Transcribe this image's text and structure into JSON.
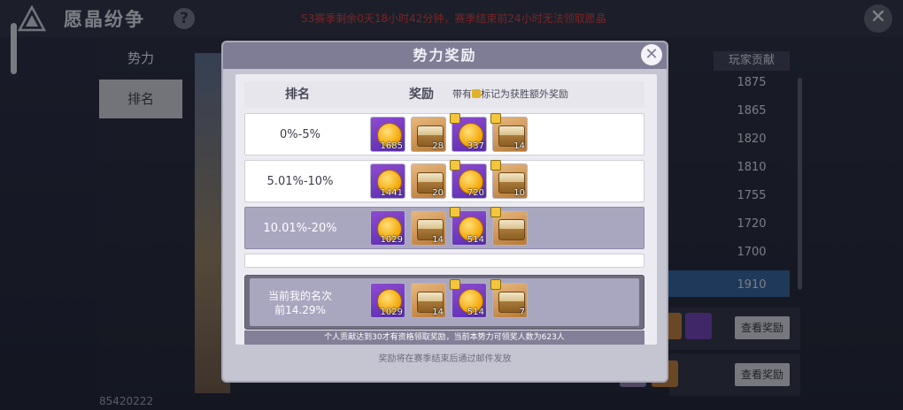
{
  "header": {
    "title": "愿晶纷争",
    "help_icon": "?",
    "notice": "S3赛季剩余0天18小时42分钟，赛季结束前24小时无法领取愿晶",
    "close_icon": "✕"
  },
  "tabs": [
    {
      "label": "势力"
    },
    {
      "label": "排名",
      "selected": true
    }
  ],
  "player_id": "85420222",
  "background_list": {
    "header": "玩家贡献",
    "values": [
      "1875",
      "1865",
      "1820",
      "1810",
      "1755",
      "1720",
      "1700",
      "1910"
    ],
    "view_button_label": "查看奖励"
  },
  "modal": {
    "title": "势力奖励",
    "close_icon": "✕",
    "columns": {
      "rank": "排名",
      "reward": "奖励",
      "note_prefix": "带有",
      "note_suffix": "标记为获胜额外奖励"
    },
    "rows": [
      {
        "rank": "0%-5%",
        "rewards": [
          {
            "type": "coin",
            "qty": "1685",
            "bonus": false
          },
          {
            "type": "chest",
            "qty": "28",
            "bonus": false
          },
          {
            "type": "coin",
            "qty": "337",
            "bonus": true
          },
          {
            "type": "chest",
            "qty": "14",
            "bonus": true
          }
        ]
      },
      {
        "rank": "5.01%-10%",
        "rewards": [
          {
            "type": "coin",
            "qty": "1441",
            "bonus": false
          },
          {
            "type": "chest",
            "qty": "20",
            "bonus": false
          },
          {
            "type": "coin",
            "qty": "720",
            "bonus": true
          },
          {
            "type": "chest",
            "qty": "10",
            "bonus": true
          }
        ]
      },
      {
        "rank": "10.01%-20%",
        "highlight": true,
        "rewards": [
          {
            "type": "coin",
            "qty": "1029",
            "bonus": false
          },
          {
            "type": "chest",
            "qty": "14",
            "bonus": false
          },
          {
            "type": "coin",
            "qty": "514",
            "bonus": true
          },
          {
            "type": "chest",
            "qty": "",
            "bonus": true
          }
        ]
      }
    ],
    "current": {
      "title": "当前我的名次",
      "value": "前14.29%",
      "rewards": [
        {
          "type": "coin",
          "qty": "1029",
          "bonus": false
        },
        {
          "type": "chest",
          "qty": "14",
          "bonus": false
        },
        {
          "type": "coin",
          "qty": "514",
          "bonus": true
        },
        {
          "type": "chest",
          "qty": "7",
          "bonus": true
        }
      ]
    },
    "info": "个人贡献达到30才有资格领取奖励，当前本势力可领奖人数为623人",
    "footer": "奖励将在赛季结束后通过邮件发放"
  },
  "colors": {
    "notice_red": "#d13a3a",
    "modal_header": "#7f7d96",
    "highlight_row": "#a9a6bf",
    "coin_bg": "#8e4bd1",
    "chest_bg": "#e8b87e"
  }
}
